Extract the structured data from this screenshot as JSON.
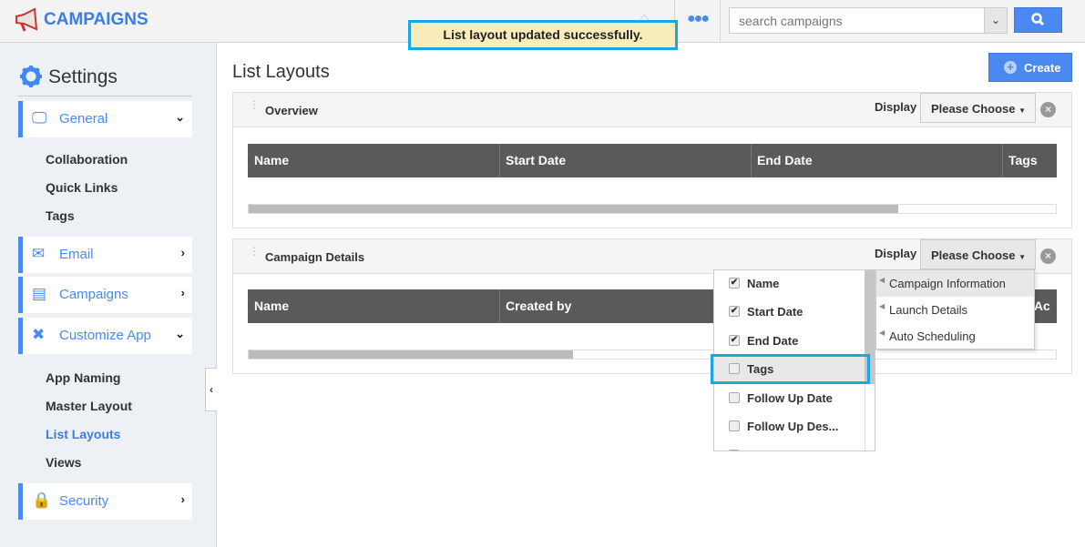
{
  "header": {
    "brand": "CAMPAIGNS",
    "search_placeholder": "search campaigns",
    "toast": "List layout updated successfully."
  },
  "sidebar": {
    "title": "Settings",
    "sections": [
      {
        "label": "General",
        "icon": "monitor-icon",
        "expanded": true,
        "items": [
          "Collaboration",
          "Quick Links",
          "Tags"
        ]
      },
      {
        "label": "Email",
        "icon": "envelope-icon",
        "expanded": false
      },
      {
        "label": "Campaigns",
        "icon": "campaigns-icon",
        "expanded": false
      },
      {
        "label": "Customize App",
        "icon": "tools-icon",
        "expanded": true,
        "items": [
          "App Naming",
          "Master Layout",
          "List Layouts",
          "Views"
        ],
        "active": "List Layouts"
      },
      {
        "label": "Security",
        "icon": "lock-icon",
        "expanded": false
      }
    ]
  },
  "main": {
    "title": "List Layouts",
    "create_label": "Create",
    "panels": [
      {
        "title": "Overview",
        "display_label": "Display",
        "select": "Please Choose",
        "columns": [
          "Name",
          "Start Date",
          "End Date",
          "Tags"
        ],
        "scroll": 0.8
      },
      {
        "title": "Campaign Details",
        "display_label": "Display",
        "select": "Please Choose",
        "columns": [
          "Name",
          "Created by",
          "n Ac"
        ],
        "scroll": 0.4
      }
    ]
  },
  "dropdown": {
    "fields": [
      {
        "label": "Name",
        "checked": true
      },
      {
        "label": "Start Date",
        "checked": true
      },
      {
        "label": "End Date",
        "checked": true
      },
      {
        "label": "Tags",
        "checked": false
      },
      {
        "label": "Follow Up Date",
        "checked": false
      },
      {
        "label": "Follow Up Des...",
        "checked": false
      }
    ],
    "groups": [
      "Campaign Information",
      "Launch Details",
      "Auto Scheduling"
    ]
  },
  "colors": {
    "accent": "#4a8af0",
    "toast_bg": "#f9ecbb",
    "highlight": "#1aa7e0",
    "table_header": "#5a5a5a"
  }
}
